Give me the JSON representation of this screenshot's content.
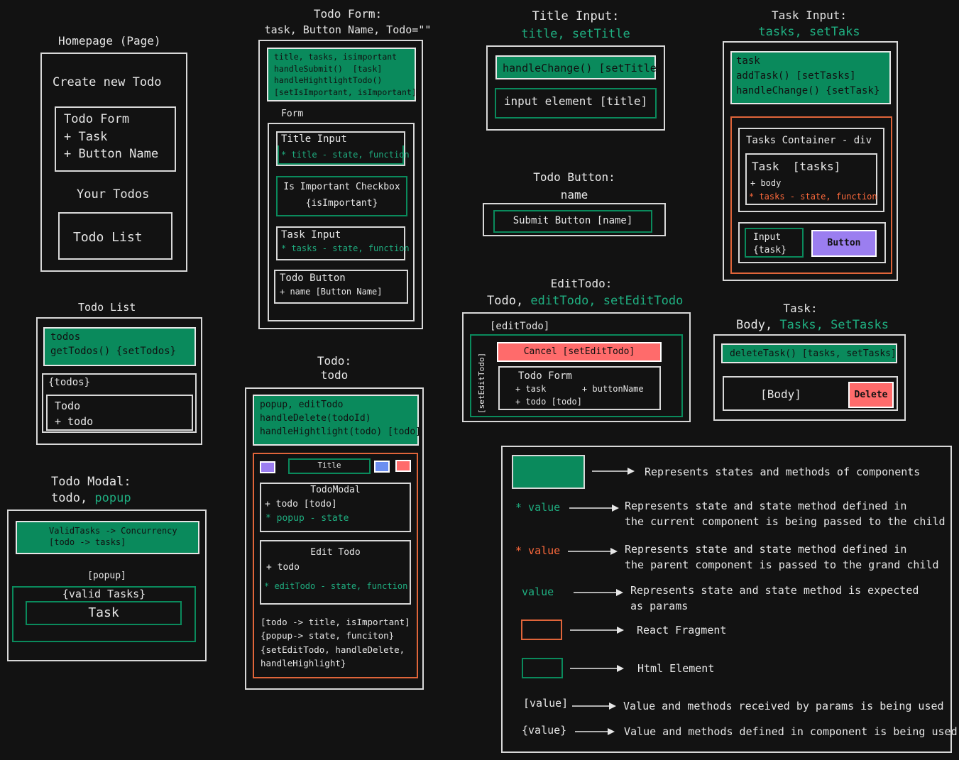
{
  "homepage": {
    "title": "Homepage (Page)",
    "create_label": "Create new Todo",
    "form_title": "Todo Form",
    "form_item1": "+ Task",
    "form_item2": "+ Button Name",
    "your_todos": "Your Todos",
    "list_label": "Todo List"
  },
  "todo_list": {
    "title": "Todo List",
    "state": "todos\ngetTodos() {setTodos}",
    "todos_label": "{todos}",
    "todo_title": "Todo",
    "todo_item": "+ todo"
  },
  "todo_modal": {
    "title": "Todo Modal:",
    "params_plain": "todo, ",
    "params_green": "popup",
    "state": "ValidTasks -> Concurrency\n[todo -> tasks]",
    "popup": "[popup]",
    "valid_tasks": "{valid Tasks}",
    "task": "Task"
  },
  "todo_form": {
    "title": "Todo Form:",
    "params": "task, Button Name, Todo=\"\"",
    "state": "title, tasks, isimportant\nhandleSubmit()  [task]\nhandleHightlightTodo()\n[setIsImportant, isImportant]",
    "form_label": "Form",
    "title_input": "Title Input",
    "title_input_sub": "* title - state, function",
    "checkbox": "Is Important Checkbox",
    "checkbox_sub": "{isImportant}",
    "task_input": "Task Input",
    "task_input_sub": "* tasks - state, function",
    "todo_button": "Todo Button",
    "todo_button_sub": "+ name [Button Name]"
  },
  "todo": {
    "title": "Todo:",
    "params": "todo",
    "state": "popup, editTodo\nhandleDelete(todoId)\nhandleHightlight(todo) [todo]",
    "title_label": "Title",
    "modal_title": "TodoModal",
    "modal_item": "+ todo [todo]",
    "modal_state": "* popup - state",
    "edit_title": "Edit Todo",
    "edit_item": "+ todo",
    "edit_state": "* editTodo - state, function",
    "notes": "[todo -> title, isImportant]\n{popup-> state, funciton}\n{setEditTodo, handleDelete,\nhandleHighlight}"
  },
  "title_input": {
    "title": "Title Input:",
    "params": "title, setTitle",
    "handler": "handleChange() [setTitle]",
    "element": "input element [title]"
  },
  "todo_button": {
    "title": "Todo Button:",
    "params": "name",
    "element": "Submit Button [name]"
  },
  "edit_todo": {
    "title": "EditTodo:",
    "params_plain": "Todo, ",
    "params_green": "editTodo, setEditTodo",
    "edit_label": "[editTodo]",
    "side_label": "[setEditTodo]",
    "cancel": "Cancel [setEditTodo]",
    "form_title": "Todo Form",
    "form_item1": "+ task       + buttonName",
    "form_item2": "+ todo [todo]"
  },
  "task_input": {
    "title": "Task Input:",
    "params": "tasks, setTaks",
    "state": "task\naddTask() [setTasks]\nhandleChange() {setTask}",
    "container": "Tasks Container - div",
    "task_title": "Task  [tasks]",
    "task_body": "+ body",
    "task_state": "* tasks - state, function",
    "input": "Input\n{task}",
    "button": "Button"
  },
  "task": {
    "title": "Task:",
    "params_plain": "Body, ",
    "params_green": "Tasks, SetTasks",
    "state": "deleteTask() [tasks, setTasks]",
    "body": "[Body]",
    "delete": "Delete"
  },
  "legend": {
    "row1": "Represents states and methods of components",
    "row2_key": "* value",
    "row2": "Represents state and state method defined in\nthe current component is being passed to the child",
    "row3_key": "* value",
    "row3": "Represents state and state method defined in\nthe parent component is passed to the grand child",
    "row4_key": "value",
    "row4": "Represents state and state method is expected\nas params",
    "row5": "React Fragment",
    "row6": "Html Element",
    "row7_key": "[value]",
    "row7": "Value and methods received by params is being used",
    "row8_key": "{value}",
    "row8": "Value and methods defined in component is being used"
  },
  "colors": {
    "green": "#0a8a5c",
    "green_text": "#1fae80",
    "orange": "#e0653a",
    "red": "#ff6b6b",
    "purple": "#9b7ef0",
    "blue": "#6b8ef0",
    "background": "#121212"
  }
}
